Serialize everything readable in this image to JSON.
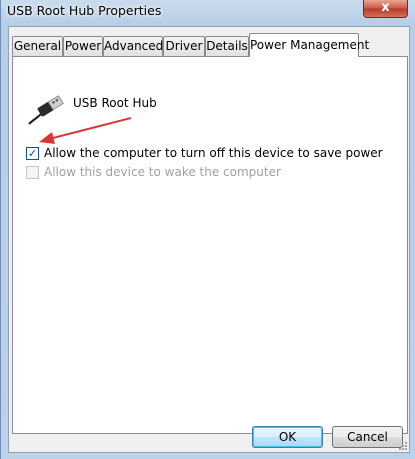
{
  "window": {
    "title": "USB Root Hub Properties",
    "close_glyph": "x"
  },
  "tabs": [
    {
      "label": "General",
      "active": false
    },
    {
      "label": "Power",
      "active": false
    },
    {
      "label": "Advanced",
      "active": false
    },
    {
      "label": "Driver",
      "active": false
    },
    {
      "label": "Details",
      "active": false
    },
    {
      "label": "Power Management",
      "active": true
    }
  ],
  "device": {
    "name": "USB Root Hub",
    "icon": "usb-plug-icon"
  },
  "options": [
    {
      "label": "Allow the computer to turn off this device to save power",
      "checked": true,
      "enabled": true
    },
    {
      "label": "Allow this device to wake the computer",
      "checked": false,
      "enabled": false
    }
  ],
  "annotation": {
    "icon": "red-arrow-icon",
    "color": "#d9363a"
  },
  "buttons": {
    "ok": "OK",
    "cancel": "Cancel"
  },
  "check_glyph": "✓"
}
